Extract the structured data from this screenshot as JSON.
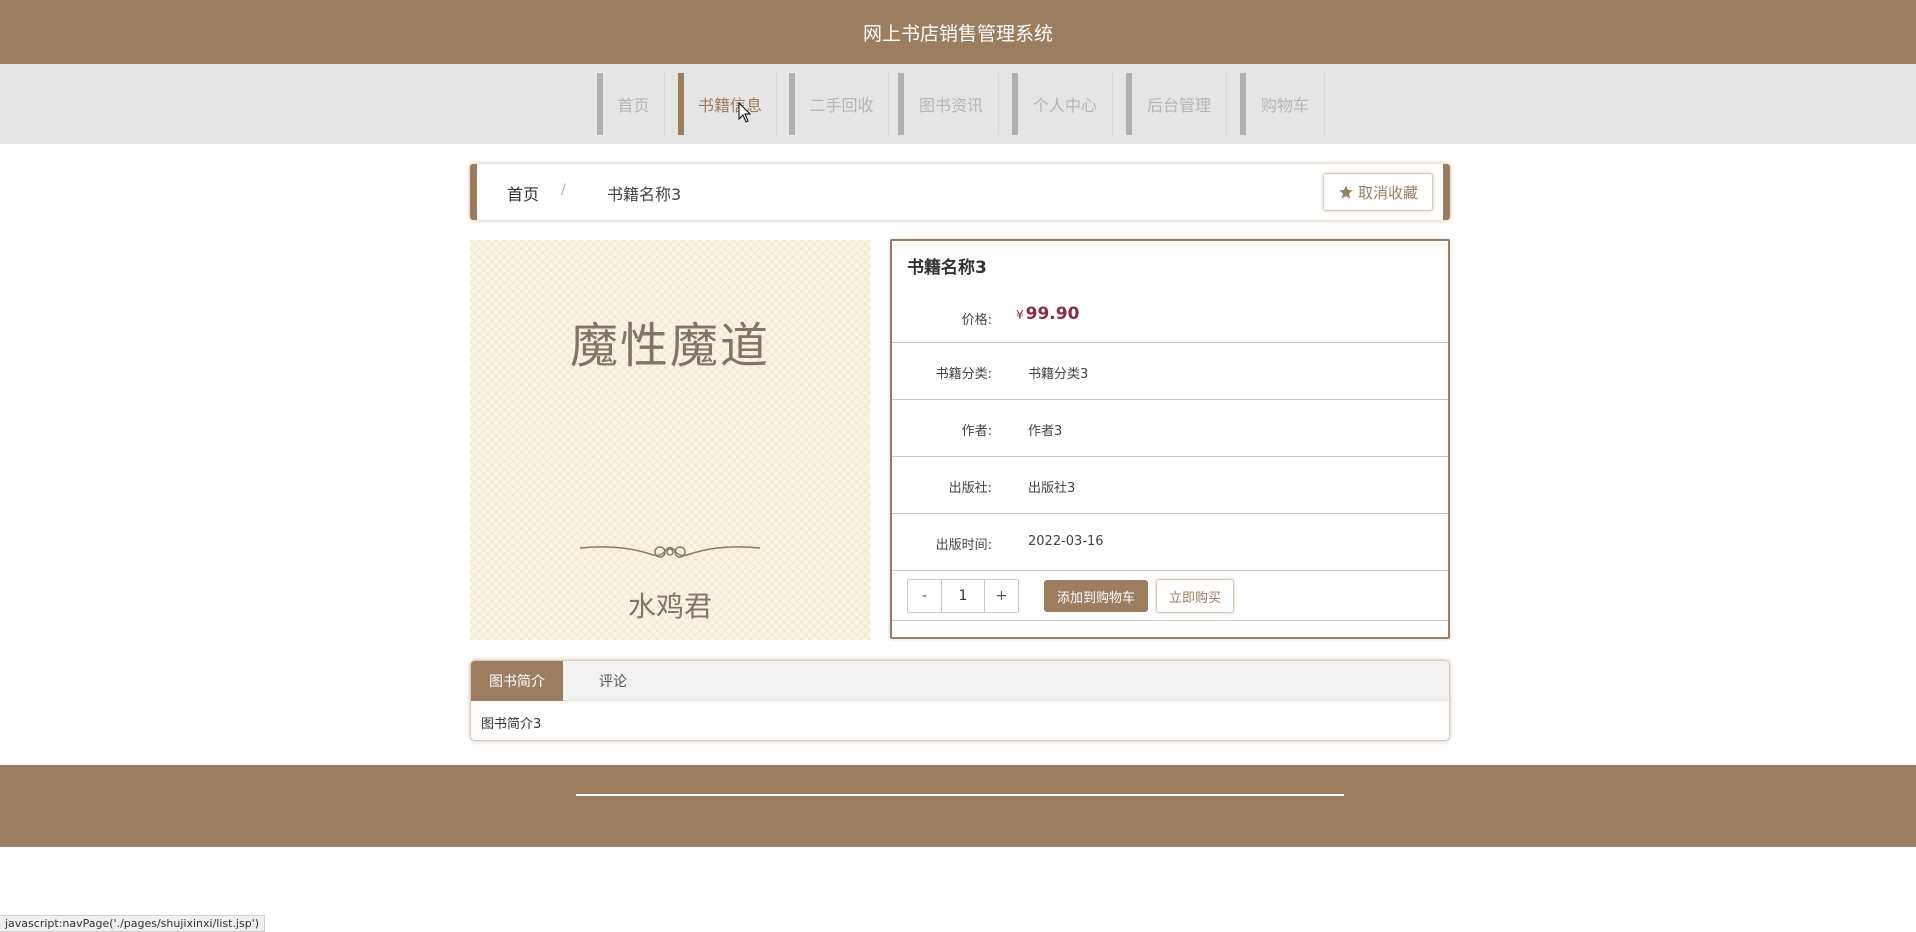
{
  "app": {
    "title": "网上书店销售管理系统"
  },
  "nav": {
    "items": [
      {
        "label": "首页"
      },
      {
        "label": "书籍信息"
      },
      {
        "label": "二手回收"
      },
      {
        "label": "图书资讯"
      },
      {
        "label": "个人中心"
      },
      {
        "label": "后台管理"
      },
      {
        "label": "购物车"
      }
    ],
    "active": "书籍信息"
  },
  "breadcrumb": {
    "home": "首页",
    "separator": "/",
    "current": "书籍名称3"
  },
  "favorite": {
    "label": "取消收藏",
    "icon": "star-icon"
  },
  "cover": {
    "title": "魔性魔道",
    "author": "水鸡君",
    "ornament": "ornament-icon"
  },
  "book": {
    "name": "书籍名称3",
    "price_label": "价格:",
    "currency": "¥",
    "price": "99.90",
    "fields": [
      {
        "label": "书籍分类:",
        "value": "书籍分类3"
      },
      {
        "label": "作者:",
        "value": "作者3"
      },
      {
        "label": "出版社:",
        "value": "出版社3"
      },
      {
        "label": "出版时间:",
        "value": "2022-03-16"
      }
    ]
  },
  "quantity": {
    "minus": "-",
    "value": "1",
    "plus": "+"
  },
  "actions": {
    "add_to_cart": "添加到购物车",
    "buy_now": "立即购买"
  },
  "tabs": {
    "items": [
      {
        "label": "图书简介"
      },
      {
        "label": "评论"
      }
    ],
    "active": "图书简介",
    "content": "图书简介3"
  },
  "status_bar": {
    "text": "javascript:navPage('./pages/shujixinxi/list.jsp')"
  },
  "colors": {
    "brand": "#9c7d60",
    "price": "#8a2a45",
    "nav_bg": "#e5e5e5"
  }
}
